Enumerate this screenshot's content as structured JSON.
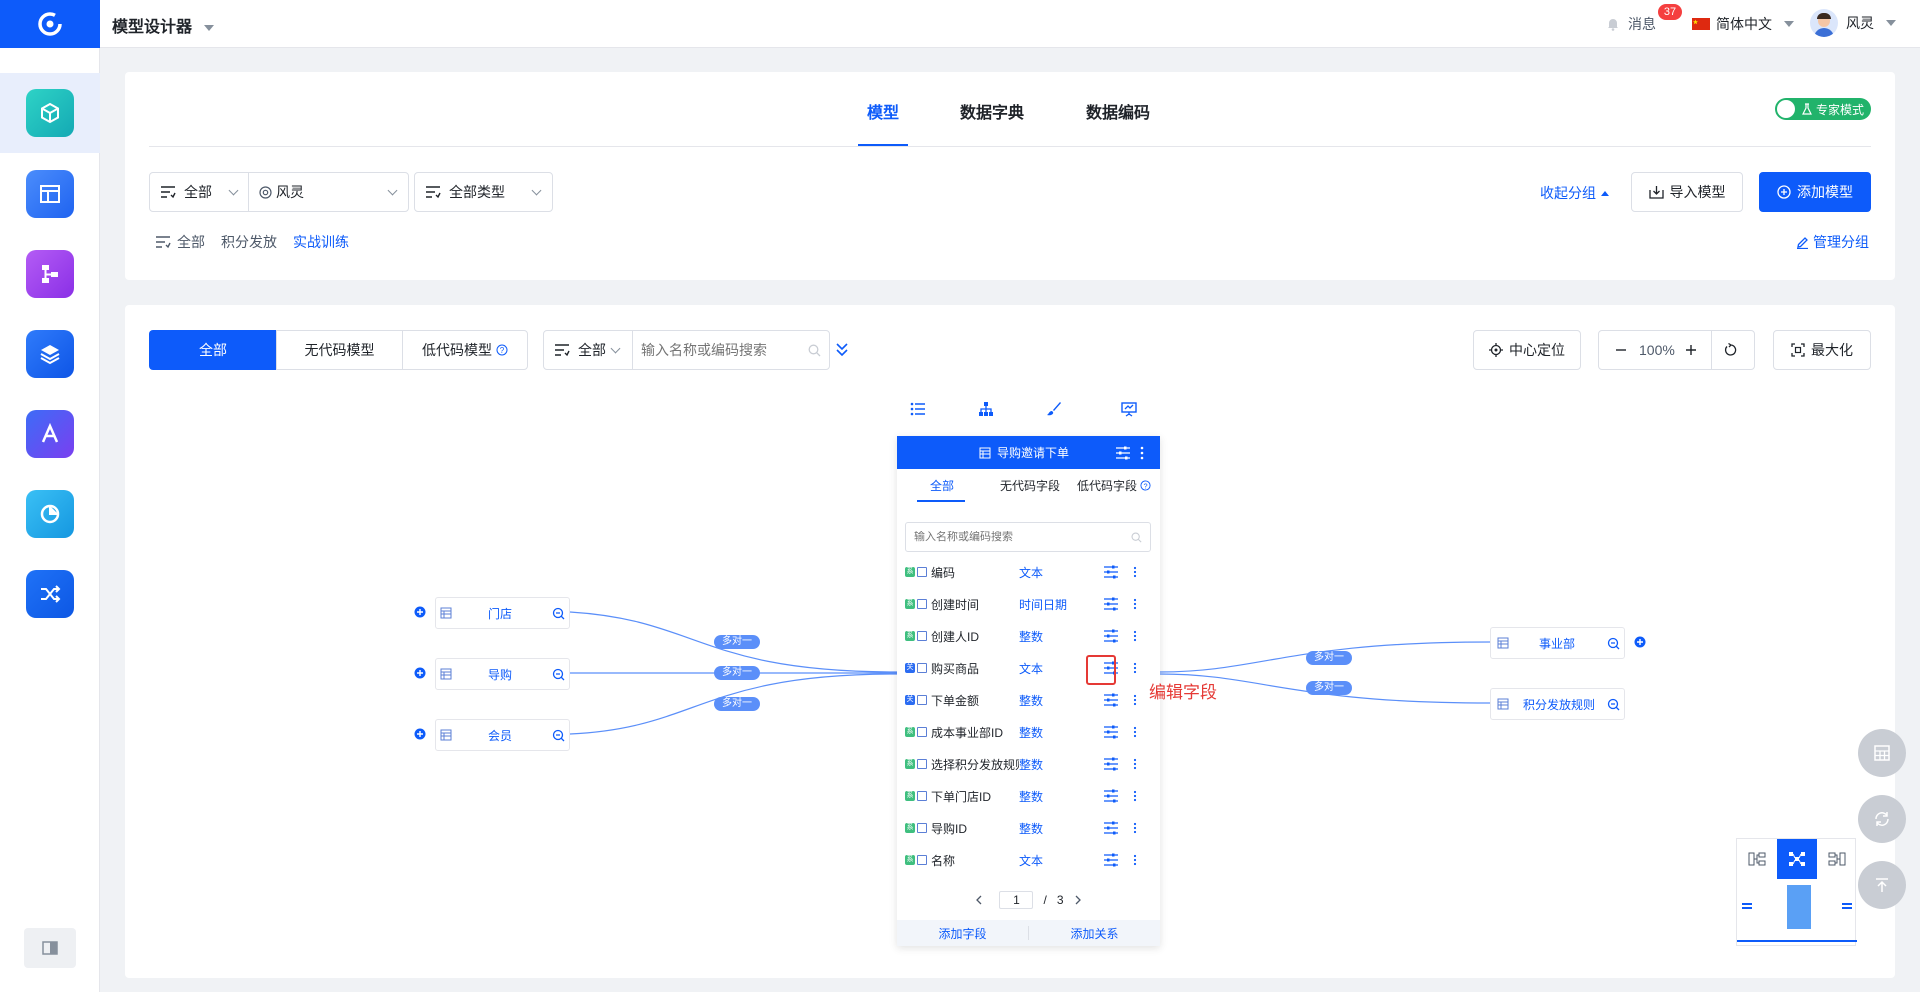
{
  "app": {
    "title": "模型设计器"
  },
  "header": {
    "messages_label": "消息",
    "messages_badge": "37",
    "language": "简体中文",
    "user_name": "风灵"
  },
  "top_tabs": {
    "model": "模型",
    "dictionary": "数据字典",
    "encoding": "数据编码"
  },
  "expert_mode": {
    "label": "专家模式",
    "on": true
  },
  "filters": {
    "scope": "全部",
    "owner": "风灵",
    "type": "全部类型"
  },
  "actions": {
    "collapse_group": "收起分组",
    "import_model": "导入模型",
    "add_model": "添加模型",
    "manage_group": "管理分组"
  },
  "groups": {
    "all": "全部",
    "items": [
      "积分发放",
      "实战训练"
    ],
    "active": "实战训练"
  },
  "model_tabs": {
    "all": "全部",
    "no_code": "无代码模型",
    "low_code": "低代码模型"
  },
  "search": {
    "scope": "全部",
    "placeholder": "输入名称或编码搜索"
  },
  "canvas_tools": {
    "center": "中心定位",
    "zoom": "100%",
    "maximize": "最大化"
  },
  "card": {
    "title": "导购邀请下单",
    "tabs": {
      "all": "全部",
      "no_code": "无代码字段",
      "low_code": "低代码字段"
    },
    "search_placeholder": "输入名称或编码搜索",
    "fields": [
      {
        "badge": "系",
        "badge_color": "#3fbf7f",
        "name": "编码",
        "type": "文本"
      },
      {
        "badge": "系",
        "badge_color": "#3fbf7f",
        "name": "创建时间",
        "type": "时间日期"
      },
      {
        "badge": "系",
        "badge_color": "#3fbf7f",
        "name": "创建人ID",
        "type": "整数"
      },
      {
        "badge": "关",
        "badge_color": "#2b6cf2",
        "name": "购买商品",
        "type": "文本"
      },
      {
        "badge": "关",
        "badge_color": "#2b6cf2",
        "name": "下单金额",
        "type": "整数"
      },
      {
        "badge": "系",
        "badge_color": "#3fbf7f",
        "name": "成本事业部ID",
        "type": "整数"
      },
      {
        "badge": "系",
        "badge_color": "#3fbf7f",
        "name": "选择积分发放规则",
        "type": "整数"
      },
      {
        "badge": "系",
        "badge_color": "#3fbf7f",
        "name": "下单门店ID",
        "type": "整数"
      },
      {
        "badge": "系",
        "badge_color": "#3fbf7f",
        "name": "导购ID",
        "type": "整数"
      },
      {
        "badge": "系",
        "badge_color": "#3fbf7f",
        "name": "名称",
        "type": "文本"
      }
    ],
    "page": {
      "current": "1",
      "separator": "/",
      "total": "3"
    },
    "add_field": "添加字段",
    "add_relation": "添加关系"
  },
  "left_nodes": [
    "门店",
    "导购",
    "会员"
  ],
  "right_nodes": [
    "事业部",
    "积分发放规则"
  ],
  "relation_label": "多对一",
  "annotation": "编辑字段",
  "colors": {
    "primary": "#0d5bfa",
    "badge_red": "#f53f3f",
    "link": "#5b8ff9",
    "highlight": "#e53935"
  }
}
